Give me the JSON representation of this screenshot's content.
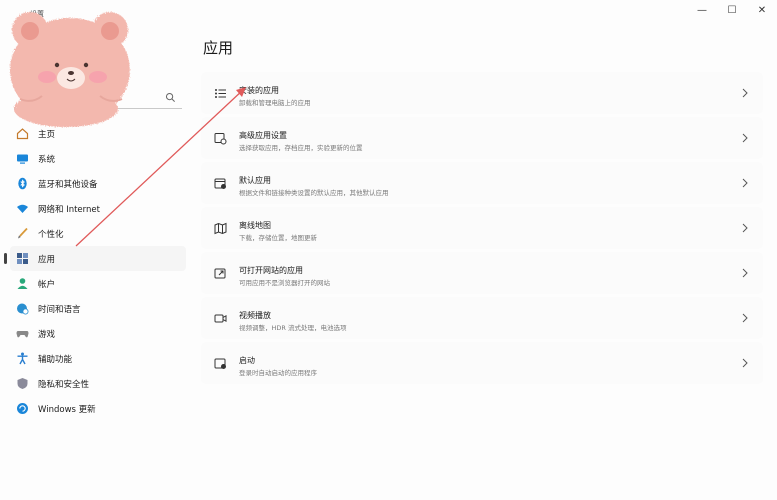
{
  "window": {
    "title": "设置",
    "controls": [
      {
        "name": "minimize",
        "glyph": "—"
      },
      {
        "name": "maximize",
        "glyph": "☐"
      },
      {
        "name": "close",
        "glyph": "✕"
      }
    ]
  },
  "search": {
    "placeholder": ""
  },
  "sidebar": {
    "items": [
      {
        "label": "主页",
        "icon": "home-icon",
        "color": "#c47a2c"
      },
      {
        "label": "系统",
        "icon": "display-icon",
        "color": "#1a86d9"
      },
      {
        "label": "蓝牙和其他设备",
        "icon": "bluetooth-icon",
        "color": "#1a86d9"
      },
      {
        "label": "网络和 Internet",
        "icon": "wifi-icon",
        "color": "#1a86d9"
      },
      {
        "label": "个性化",
        "icon": "brush-icon",
        "color": "#d99a3a"
      },
      {
        "label": "应用",
        "icon": "apps-icon",
        "color": "#3a5b8a",
        "active": true
      },
      {
        "label": "帐户",
        "icon": "person-icon",
        "color": "#29a87a"
      },
      {
        "label": "时间和语言",
        "icon": "globe-clock-icon",
        "color": "#2a8fd0"
      },
      {
        "label": "游戏",
        "icon": "controller-icon",
        "color": "#888888"
      },
      {
        "label": "辅助功能",
        "icon": "accessibility-icon",
        "color": "#2a7fd0"
      },
      {
        "label": "隐私和安全性",
        "icon": "shield-icon",
        "color": "#8a8a9a"
      },
      {
        "label": "Windows 更新",
        "icon": "update-icon",
        "color": "#1a86d9"
      }
    ]
  },
  "main": {
    "title": "应用",
    "cards": [
      {
        "title": "安装的应用",
        "desc": "卸载和管理电脑上的应用",
        "icon": "list-icon"
      },
      {
        "title": "高级应用设置",
        "desc": "选择获取应用，存档应用，实验更新的位置",
        "icon": "settings-app-icon"
      },
      {
        "title": "默认应用",
        "desc": "根据文件和链接种类设置的默认应用，其他默认应用",
        "icon": "default-app-icon"
      },
      {
        "title": "离线地图",
        "desc": "下载，存储位置，地图更新",
        "icon": "map-icon"
      },
      {
        "title": "可打开网站的应用",
        "desc": "可用应用不是浏览器打开的网站",
        "icon": "open-web-icon"
      },
      {
        "title": "视频播放",
        "desc": "视频调整，HDR 流式处理，电池选项",
        "icon": "video-icon"
      },
      {
        "title": "启动",
        "desc": "登录时自动启动的应用程序",
        "icon": "startup-icon"
      }
    ]
  },
  "annotation": {
    "arrow_color": "#e05a5a"
  }
}
